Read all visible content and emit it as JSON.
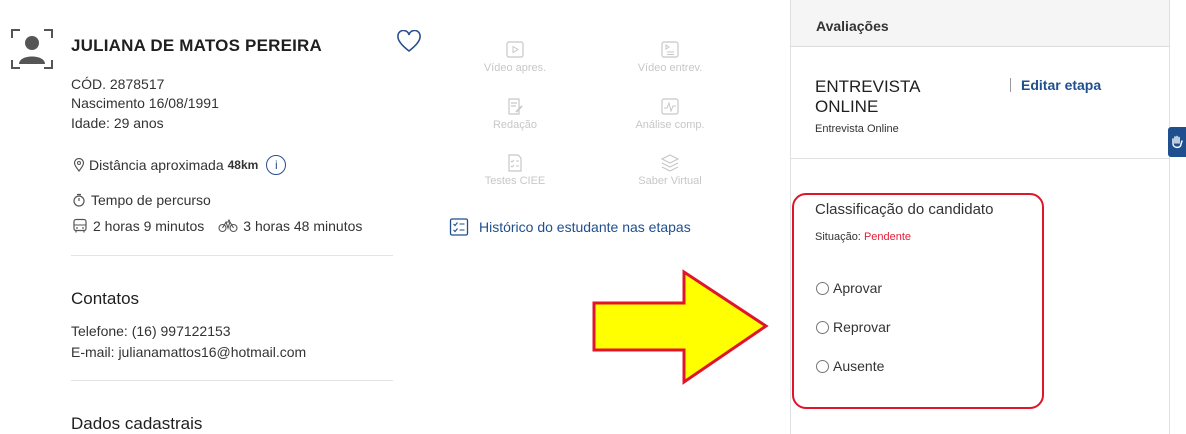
{
  "candidate": {
    "name": "JULIANA DE MATOS PEREIRA",
    "code": "CÓD. 2878517",
    "birth": "Nascimento 16/08/1991",
    "age": "Idade: 29 anos",
    "distance_label": "Distância aproximada",
    "distance_value": "48km",
    "travel_label": "Tempo de percurso",
    "travel_bus": "2 horas 9 minutos",
    "travel_bike": "3 horas 48 minutos"
  },
  "contacts": {
    "title": "Contatos",
    "phone": "Telefone: (16) 997122153",
    "email": "E-mail: julianamattos16@hotmail.com"
  },
  "registration": {
    "title": "Dados cadastrais"
  },
  "tools": {
    "video_pres": "Vídeo apres.",
    "video_entrev": "Vídeo entrev.",
    "redacao": "Redação",
    "analise": "Análise comp.",
    "testes": "Testes CIEE",
    "saber": "Saber Virtual",
    "historico": "Histórico do estudante nas etapas"
  },
  "evaluation": {
    "header": "Avaliações",
    "stage_title_line1": "ENTREVISTA",
    "stage_title_line2": "ONLINE",
    "stage_subtitle": "Entrevista Online",
    "edit_link": "Editar etapa",
    "classification_title": "Classificação do candidato",
    "status_label": "Situação:",
    "status_value": "Pendente",
    "options": [
      "Aprovar",
      "Reprovar",
      "Ausente"
    ]
  },
  "colors": {
    "accent": "#1f4f8f",
    "pending": "#e0203a",
    "highlight_border": "#e0142a",
    "arrow_fill": "#ffff00",
    "arrow_stroke": "#e0142a"
  }
}
